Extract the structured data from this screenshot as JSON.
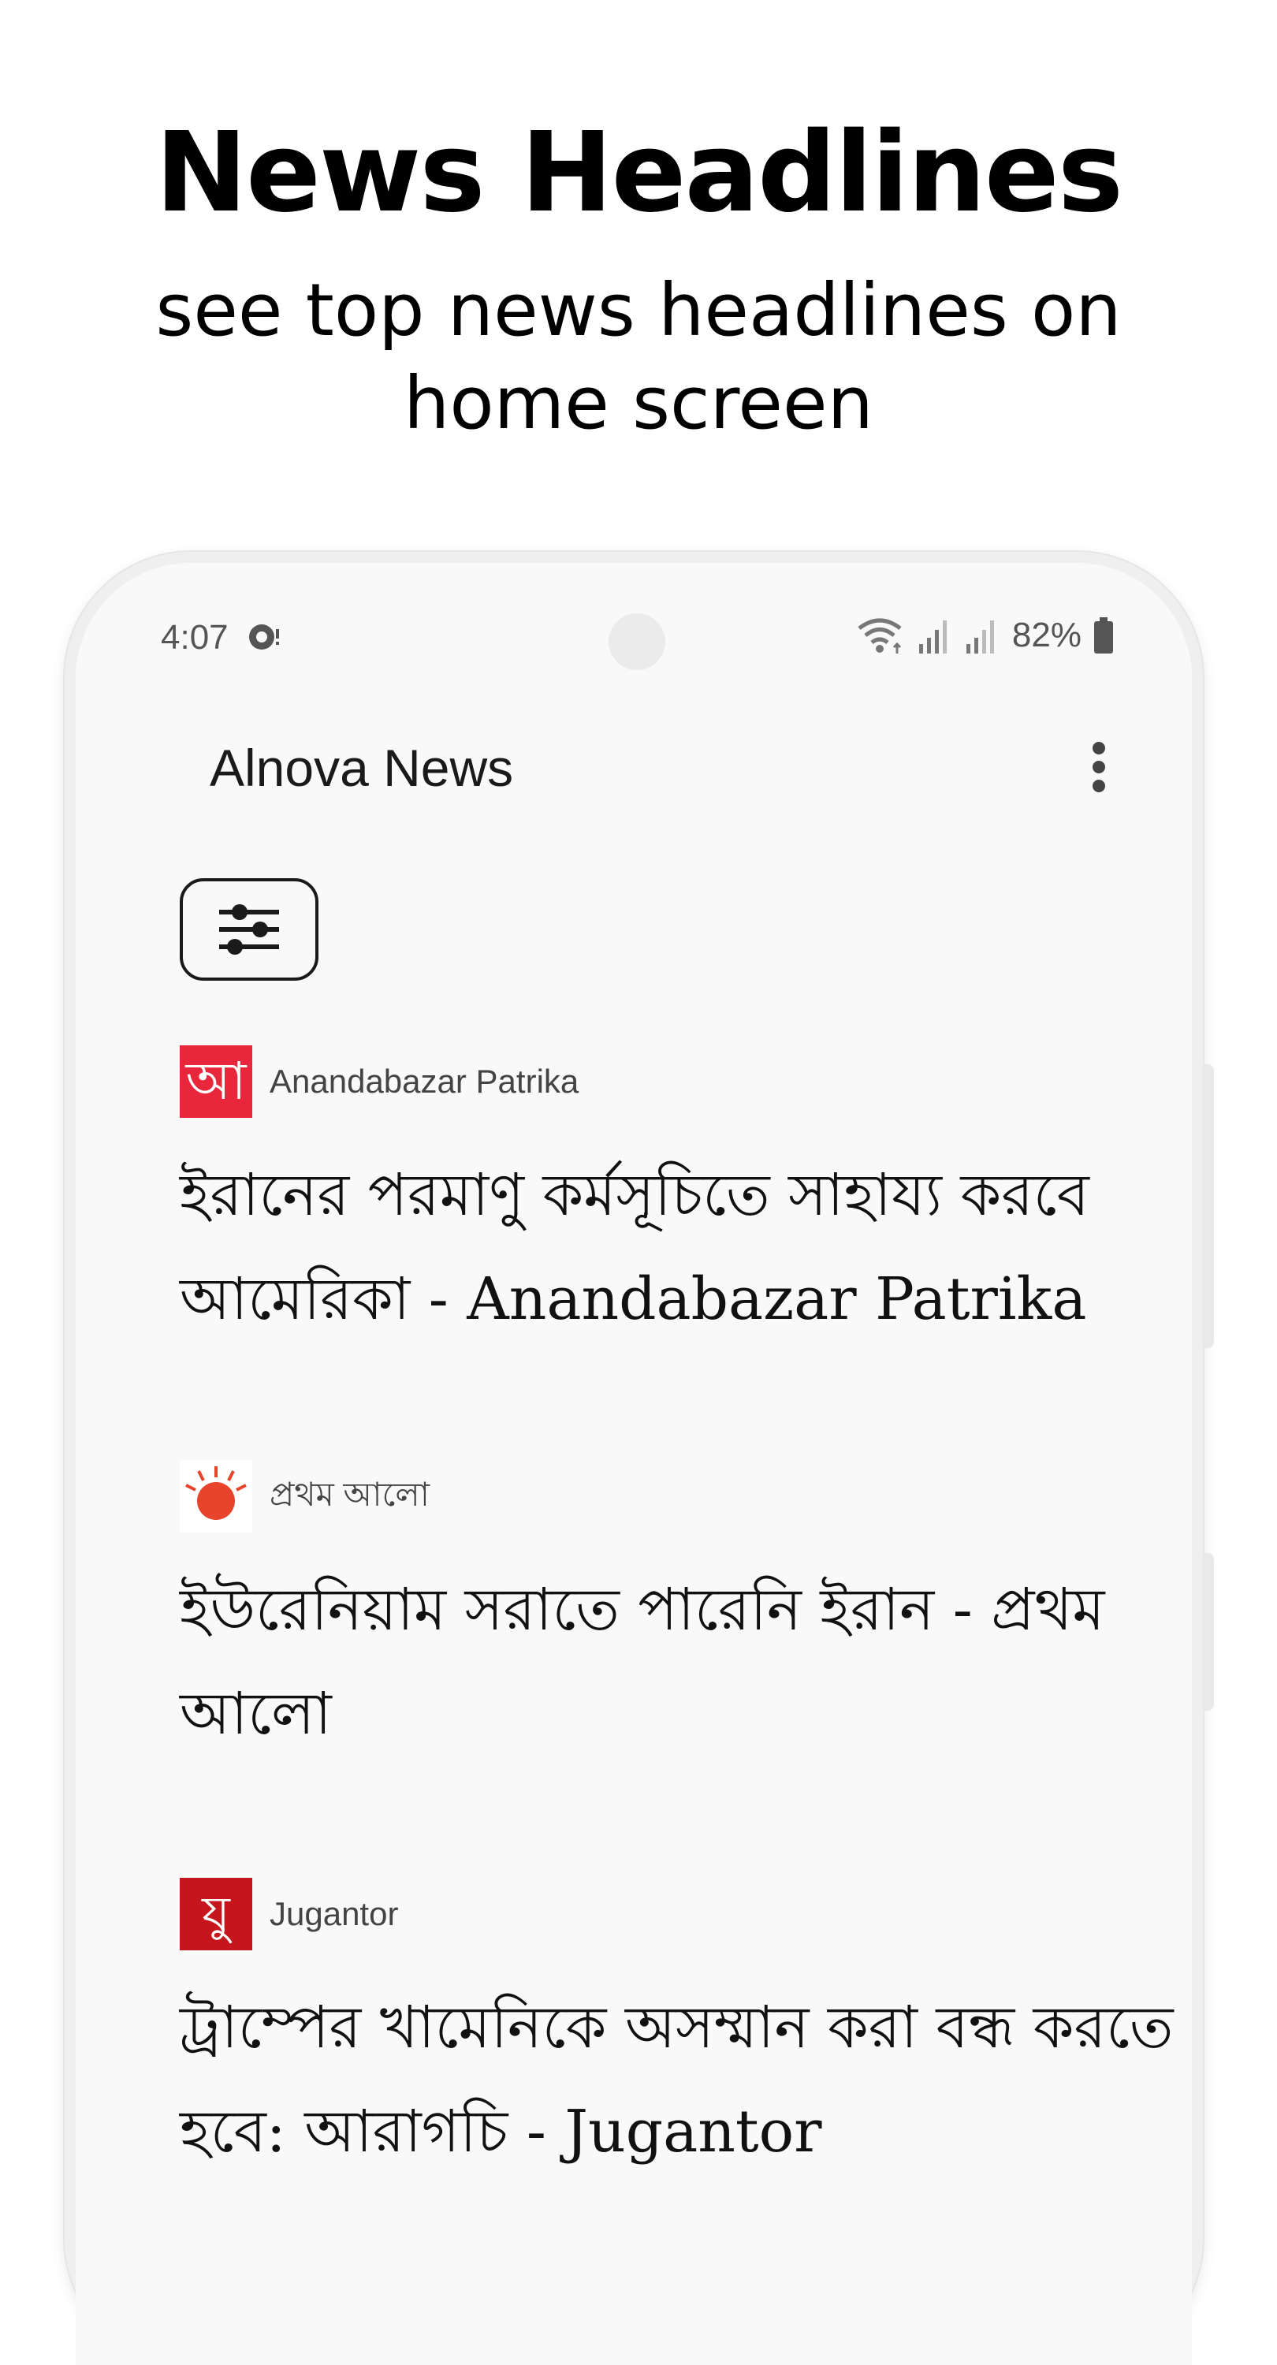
{
  "promo": {
    "title": "News Headlines",
    "subtitle": "see top news headlines on home screen"
  },
  "status_bar": {
    "time": "4:07",
    "battery": "82%",
    "icons": [
      "chat-bubble-icon",
      "wifi-icon",
      "signal-icon",
      "signal-icon",
      "battery-icon"
    ]
  },
  "app_bar": {
    "title": "Alnova News",
    "menu_icon": "more-vert-icon"
  },
  "filter": {
    "icon": "tune-icon"
  },
  "news": [
    {
      "source": "Anandabazar Patrika",
      "logo_text": "আ",
      "logo_color": "#e8263c",
      "headline": "ইরানের পরমাণু কর্মসূচিতে সাহায্য করবে আমেরিকা - Anandabazar Patrika"
    },
    {
      "source": "প্রথম আলো",
      "logo_icon": "sun-icon",
      "logo_color": "#e8432b",
      "headline": "ইউরেনিয়াম সরাতে পারেনি ইরান - প্রথম আলো"
    },
    {
      "source": "Jugantor",
      "logo_text": "যু",
      "logo_color": "#c4161c",
      "headline": "ট্রাম্পের খামেনিকে অসম্মান করা বন্ধ করতে হবে: আরাগচি - Jugantor"
    }
  ]
}
